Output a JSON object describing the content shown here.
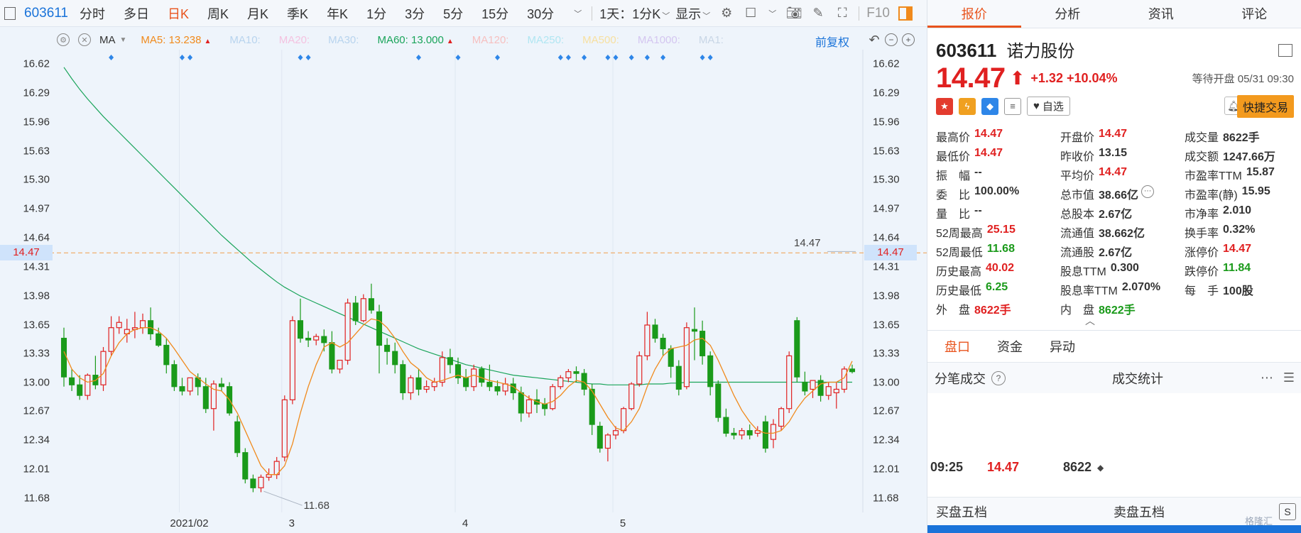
{
  "toolbar": {
    "code": "603611",
    "periods": [
      "分时",
      "多日",
      "日K",
      "周K",
      "月K",
      "季K",
      "年K",
      "1分",
      "3分",
      "5分",
      "15分",
      "30分"
    ],
    "active_period": "日K",
    "interval": "1天：1分K",
    "display": "显示",
    "f10": "F10"
  },
  "ma_bar": {
    "selector": "MA",
    "items": [
      {
        "label": "MA5: 13.238",
        "color": "#f08a1c",
        "up": true
      },
      {
        "label": "MA10:",
        "color": "#b8d4ee",
        "up": false
      },
      {
        "label": "MA20:",
        "color": "#f4c2e0",
        "up": false
      },
      {
        "label": "MA30:",
        "color": "#b8d4ee",
        "up": false
      },
      {
        "label": "MA60: 13.000",
        "color": "#1aa45a",
        "up": true
      },
      {
        "label": "MA120:",
        "color": "#f6c0c0",
        "up": false
      },
      {
        "label": "MA250:",
        "color": "#b0e6f2",
        "up": false
      },
      {
        "label": "MA500:",
        "color": "#f7e0a0",
        "up": false
      },
      {
        "label": "MA1000:",
        "color": "#d4c6f0",
        "up": false
      },
      {
        "label": "MA1:",
        "color": "#c8d6e6",
        "up": false
      }
    ],
    "restore": "前复权",
    "up_mark": "▲"
  },
  "axis": {
    "ticks": [
      "16.62",
      "16.29",
      "15.96",
      "15.63",
      "15.30",
      "14.97",
      "14.64",
      "14.31",
      "13.98",
      "13.65",
      "13.33",
      "13.00",
      "12.67",
      "12.34",
      "12.01",
      "11.68"
    ],
    "current": "14.47",
    "x_labels": [
      "2021/02",
      "3",
      "4",
      "5"
    ]
  },
  "annotations": {
    "high_line": "14.47",
    "low_point": "11.68"
  },
  "colors": {
    "up": "#e02020",
    "down": "#1a9a1a",
    "accent": "#e8531c",
    "ma5": "#f08a1c",
    "ma60": "#1aa45a"
  },
  "chart_data": {
    "type": "candlestick",
    "ylim": [
      11.52,
      16.78
    ],
    "candles": [
      [
        13.5,
        13.62,
        13.06,
        12.95
      ],
      [
        13.05,
        13.15,
        12.97,
        12.9
      ],
      [
        12.97,
        13.08,
        12.85,
        12.8
      ],
      [
        12.85,
        13.1,
        13.08,
        12.8
      ],
      [
        13.08,
        13.3,
        12.97,
        12.92
      ],
      [
        12.97,
        13.4,
        13.35,
        12.9
      ],
      [
        13.35,
        13.75,
        13.62,
        13.3
      ],
      [
        13.62,
        13.75,
        13.68,
        13.55
      ],
      [
        13.55,
        13.72,
        13.6,
        13.45
      ],
      [
        13.6,
        13.8,
        13.62,
        13.5
      ],
      [
        13.62,
        13.78,
        13.7,
        13.55
      ],
      [
        13.7,
        13.85,
        13.55,
        13.48
      ],
      [
        13.55,
        13.62,
        13.42,
        13.4
      ],
      [
        13.42,
        13.5,
        13.2,
        13.1
      ],
      [
        13.2,
        13.25,
        12.95,
        12.9
      ],
      [
        12.95,
        13.05,
        12.9,
        12.85
      ],
      [
        12.9,
        13.0,
        13.05,
        12.85
      ],
      [
        13.05,
        13.1,
        12.95,
        12.85
      ],
      [
        12.95,
        13.05,
        12.7,
        12.65
      ],
      [
        12.7,
        13.02,
        12.98,
        12.45
      ],
      [
        12.98,
        13.05,
        12.95,
        12.9
      ],
      [
        12.95,
        13.0,
        12.65,
        12.62
      ],
      [
        12.55,
        12.62,
        12.2,
        12.15
      ],
      [
        12.2,
        12.25,
        11.9,
        11.85
      ],
      [
        11.9,
        11.95,
        11.8,
        11.75
      ],
      [
        11.8,
        11.95,
        11.92,
        11.75
      ],
      [
        11.92,
        12.02,
        11.95,
        11.88
      ],
      [
        11.95,
        12.15,
        12.1,
        11.9
      ],
      [
        12.15,
        12.85,
        12.8,
        12.1
      ],
      [
        12.8,
        13.75,
        13.7,
        12.75
      ],
      [
        13.7,
        13.95,
        13.5,
        13.45
      ],
      [
        13.5,
        13.58,
        13.48,
        13.4
      ],
      [
        13.48,
        13.55,
        13.52,
        13.42
      ],
      [
        13.52,
        13.6,
        13.45,
        13.35
      ],
      [
        13.45,
        13.58,
        13.15,
        13.1
      ],
      [
        13.15,
        13.25,
        13.25,
        13.1
      ],
      [
        13.25,
        13.95,
        13.9,
        13.2
      ],
      [
        13.9,
        13.98,
        13.7,
        13.65
      ],
      [
        13.7,
        14.0,
        13.95,
        13.68
      ],
      [
        13.95,
        14.12,
        13.82,
        13.78
      ],
      [
        13.8,
        13.88,
        13.42,
        13.1
      ],
      [
        13.42,
        13.5,
        13.35,
        13.2
      ],
      [
        13.35,
        13.45,
        13.2,
        13.1
      ],
      [
        13.2,
        13.25,
        12.88,
        12.8
      ],
      [
        12.88,
        13.08,
        13.05,
        12.8
      ],
      [
        13.05,
        13.15,
        12.92,
        12.85
      ],
      [
        12.92,
        13.02,
        12.95,
        12.88
      ],
      [
        12.95,
        13.05,
        13.0,
        12.9
      ],
      [
        13.0,
        13.35,
        13.28,
        12.95
      ],
      [
        13.28,
        13.38,
        13.2,
        13.1
      ],
      [
        13.2,
        13.28,
        13.05,
        12.98
      ],
      [
        13.05,
        13.15,
        12.95,
        12.9
      ],
      [
        12.95,
        13.2,
        13.15,
        12.9
      ],
      [
        13.15,
        13.18,
        13.0,
        12.95
      ],
      [
        13.0,
        13.2,
        12.95,
        12.9
      ],
      [
        12.95,
        13.02,
        12.9,
        12.85
      ],
      [
        12.9,
        13.05,
        12.98,
        12.85
      ],
      [
        12.98,
        13.05,
        12.88,
        12.8
      ],
      [
        12.88,
        12.95,
        12.65,
        12.55
      ],
      [
        12.65,
        12.85,
        12.8,
        12.6
      ],
      [
        12.8,
        12.92,
        12.75,
        12.65
      ],
      [
        12.75,
        12.82,
        12.7,
        12.62
      ],
      [
        12.7,
        12.98,
        12.95,
        12.68
      ],
      [
        12.95,
        13.08,
        13.05,
        12.92
      ],
      [
        13.05,
        13.15,
        13.12,
        13.0
      ],
      [
        13.12,
        13.18,
        13.1,
        13.0
      ],
      [
        13.1,
        13.15,
        12.92,
        12.85
      ],
      [
        12.92,
        12.98,
        12.52,
        12.4
      ],
      [
        12.5,
        12.55,
        12.25,
        12.2
      ],
      [
        12.25,
        12.42,
        12.4,
        12.1
      ],
      [
        12.4,
        12.5,
        12.45,
        12.35
      ],
      [
        12.45,
        12.72,
        12.7,
        12.42
      ],
      [
        12.7,
        13.0,
        12.98,
        12.68
      ],
      [
        12.98,
        13.35,
        13.3,
        12.95
      ],
      [
        13.3,
        13.8,
        13.65,
        13.25
      ],
      [
        13.65,
        13.72,
        13.5,
        13.45
      ],
      [
        13.5,
        13.55,
        13.38,
        13.3
      ],
      [
        13.38,
        13.42,
        13.18,
        13.05
      ],
      [
        13.18,
        13.25,
        12.92,
        12.85
      ],
      [
        12.95,
        13.68,
        13.62,
        12.92
      ],
      [
        13.6,
        13.85,
        13.58,
        13.25
      ],
      [
        13.58,
        13.7,
        13.3,
        13.2
      ],
      [
        13.3,
        13.35,
        12.95,
        12.85
      ],
      [
        12.98,
        13.02,
        12.6,
        12.55
      ],
      [
        12.6,
        12.7,
        12.42,
        12.38
      ],
      [
        12.42,
        12.48,
        12.4,
        12.35
      ],
      [
        12.4,
        12.48,
        12.45,
        12.35
      ],
      [
        12.45,
        12.52,
        12.4,
        12.35
      ],
      [
        12.42,
        12.5,
        12.45,
        12.38
      ],
      [
        12.55,
        12.62,
        12.25,
        12.2
      ],
      [
        12.35,
        12.58,
        12.52,
        12.25
      ],
      [
        12.5,
        12.72,
        12.7,
        12.45
      ],
      [
        12.7,
        13.35,
        13.3,
        12.65
      ],
      [
        13.7,
        13.74,
        13.06,
        13.0
      ],
      [
        13.0,
        13.12,
        12.9,
        12.85
      ],
      [
        12.92,
        13.02,
        13.02,
        12.82
      ],
      [
        13.02,
        13.08,
        12.85,
        12.78
      ],
      [
        12.85,
        13.0,
        12.95,
        12.8
      ],
      [
        12.88,
        13.0,
        12.92,
        12.7
      ],
      [
        12.92,
        13.18,
        13.15,
        12.88
      ],
      [
        13.15,
        13.2,
        13.12,
        13.1
      ]
    ],
    "ma5": [
      13.35,
      13.15,
      13.05,
      13.0,
      13.02,
      13.1,
      13.3,
      13.45,
      13.55,
      13.6,
      13.62,
      13.62,
      13.58,
      13.5,
      13.38,
      13.25,
      13.12,
      13.05,
      12.98,
      12.92,
      12.9,
      12.8,
      12.65,
      12.45,
      12.25,
      12.05,
      11.95,
      11.95,
      12.05,
      12.3,
      12.65,
      12.95,
      13.2,
      13.4,
      13.45,
      13.4,
      13.45,
      13.55,
      13.65,
      13.72,
      13.7,
      13.62,
      13.5,
      13.35,
      13.22,
      13.15,
      13.05,
      13.0,
      13.02,
      13.05,
      13.08,
      13.05,
      13.08,
      13.05,
      13.02,
      13.0,
      12.98,
      12.95,
      12.88,
      12.82,
      12.78,
      12.75,
      12.78,
      12.85,
      12.95,
      13.02,
      13.0,
      12.9,
      12.75,
      12.6,
      12.48,
      12.45,
      12.55,
      12.7,
      12.95,
      13.15,
      13.3,
      13.38,
      13.4,
      13.42,
      13.48,
      13.5,
      13.42,
      13.25,
      13.05,
      12.85,
      12.68,
      12.55,
      12.45,
      12.42,
      12.42,
      12.45,
      12.55,
      12.7,
      12.82,
      12.9,
      12.98,
      13.0,
      13.0,
      13.05,
      13.24
    ],
    "ma60": [
      16.58,
      16.45,
      16.33,
      16.22,
      16.12,
      16.02,
      15.93,
      15.84,
      15.75,
      15.66,
      15.57,
      15.48,
      15.39,
      15.3,
      15.21,
      15.12,
      15.03,
      14.94,
      14.85,
      14.76,
      14.67,
      14.59,
      14.51,
      14.43,
      14.35,
      14.28,
      14.21,
      14.14,
      14.08,
      14.03,
      13.98,
      13.94,
      13.9,
      13.86,
      13.82,
      13.78,
      13.74,
      13.7,
      13.66,
      13.62,
      13.58,
      13.54,
      13.5,
      13.46,
      13.42,
      13.38,
      13.35,
      13.32,
      13.29,
      13.26,
      13.23,
      13.2,
      13.18,
      13.16,
      13.14,
      13.12,
      13.1,
      13.08,
      13.07,
      13.06,
      13.05,
      13.04,
      13.03,
      13.02,
      13.01,
      13.0,
      12.99,
      12.98,
      12.98,
      12.97,
      12.97,
      12.97,
      12.97,
      12.97,
      12.98,
      12.98,
      12.98,
      12.99,
      12.99,
      13.0,
      13.0,
      13.0,
      13.0,
      13.0,
      13.0,
      13.0,
      13.0,
      13.0,
      13.0,
      13.0,
      13.0,
      13.0,
      13.0,
      13.0,
      13.0,
      13.0,
      13.0,
      13.0,
      13.0,
      13.0,
      13.0
    ],
    "marker_indices": [
      6,
      15,
      16,
      30,
      31,
      45,
      50,
      55,
      63,
      64,
      66,
      69,
      70,
      72,
      74,
      76,
      81,
      82
    ],
    "x_label_indices": [
      15,
      28,
      50,
      70
    ],
    "hline": 14.47,
    "low": 11.68
  },
  "quote": {
    "tabs": [
      "报价",
      "分析",
      "资讯",
      "评论"
    ],
    "active_tab": "报价",
    "code": "603611",
    "name": "诺力股份",
    "price": "14.47",
    "arrow": "⬆",
    "change": "+1.32",
    "change_pct": "+10.04%",
    "status": "等待开盘 05/31 09:30",
    "fav": "自选",
    "quick_trade": "快捷交易",
    "stats": [
      [
        {
          "k": "最高价",
          "v": "14.47",
          "c": "red"
        },
        {
          "k": "开盘价",
          "v": "14.47",
          "c": "red"
        },
        {
          "k": "成交量",
          "v": "8622手",
          "c": ""
        }
      ],
      [
        {
          "k": "最低价",
          "v": "14.47",
          "c": "red"
        },
        {
          "k": "昨收价",
          "v": "13.15",
          "c": ""
        },
        {
          "k": "成交额",
          "v": "1247.66万",
          "c": ""
        }
      ],
      [
        {
          "k": "振　幅",
          "v": "--",
          "c": ""
        },
        {
          "k": "平均价",
          "v": "14.47",
          "c": "red"
        },
        {
          "k": "市盈率TTM",
          "v": "15.87",
          "c": ""
        }
      ],
      [
        {
          "k": "委　比",
          "v": "100.00%",
          "c": ""
        },
        {
          "k": "总市值",
          "v": "38.66亿",
          "c": "",
          "more": true
        },
        {
          "k": "市盈率(静)",
          "v": "15.95",
          "c": ""
        }
      ],
      [
        {
          "k": "量　比",
          "v": "--",
          "c": ""
        },
        {
          "k": "总股本",
          "v": "2.67亿",
          "c": ""
        },
        {
          "k": "市净率",
          "v": "2.010",
          "c": ""
        }
      ],
      [
        {
          "k": "52周最高",
          "v": "25.15",
          "c": "red"
        },
        {
          "k": "流通值",
          "v": "38.662亿",
          "c": ""
        },
        {
          "k": "换手率",
          "v": "0.32%",
          "c": ""
        }
      ],
      [
        {
          "k": "52周最低",
          "v": "11.68",
          "c": "green"
        },
        {
          "k": "流通股",
          "v": "2.67亿",
          "c": ""
        },
        {
          "k": "涨停价",
          "v": "14.47",
          "c": "red"
        }
      ],
      [
        {
          "k": "历史最高",
          "v": "40.02",
          "c": "red"
        },
        {
          "k": "股息TTM",
          "v": "0.300",
          "c": ""
        },
        {
          "k": "跌停价",
          "v": "11.84",
          "c": "green"
        }
      ],
      [
        {
          "k": "历史最低",
          "v": "6.25",
          "c": "green"
        },
        {
          "k": "股息率TTM",
          "v": "2.070%",
          "c": ""
        },
        {
          "k": "每　手",
          "v": "100股",
          "c": ""
        }
      ],
      [
        {
          "k": "外　盘",
          "v": "8622手",
          "c": "red"
        },
        {
          "k": "内　盘",
          "v": "8622手",
          "c": "green"
        },
        {
          "k": "",
          "v": "",
          "c": ""
        }
      ]
    ],
    "sub_tabs": [
      "盘口",
      "资金",
      "异动"
    ],
    "ticks_title": "分笔成交",
    "stats_title": "成交统计",
    "tick": {
      "time": "09:25",
      "price": "14.47",
      "volume": "8622"
    },
    "buy_title": "买盘五档",
    "sell_title": "卖盘五档",
    "watermark": "格隆汇"
  }
}
